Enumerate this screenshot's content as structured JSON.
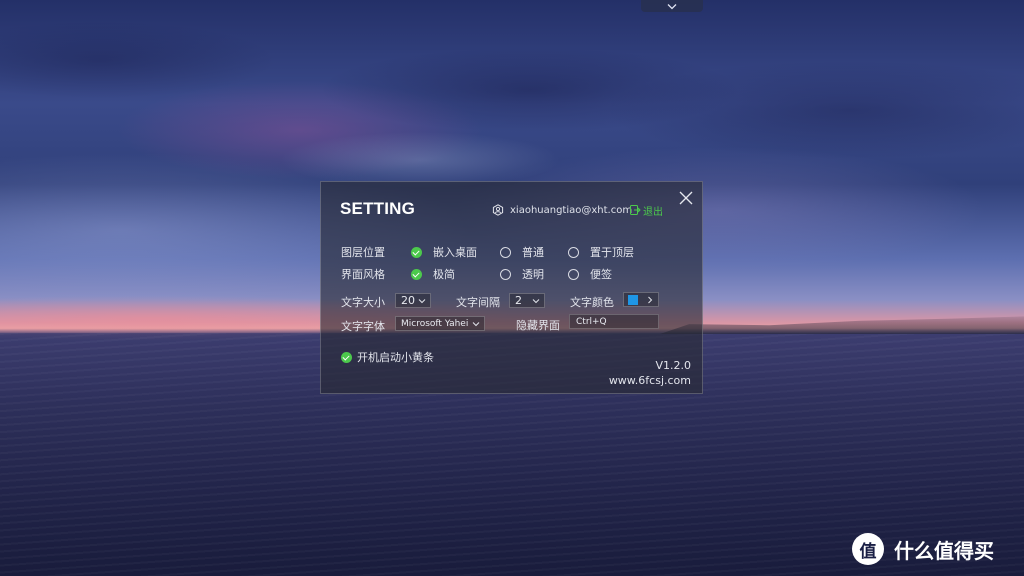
{
  "panel": {
    "title": "SETTING",
    "user_email": "xiaohuangtiao@xht.com",
    "logout_label": "退出",
    "rows": {
      "layer": {
        "label": "图层位置",
        "options": [
          "嵌入桌面",
          "普通",
          "置于顶层"
        ],
        "selected": "嵌入桌面"
      },
      "style": {
        "label": "界面风格",
        "options": [
          "极简",
          "透明",
          "便签"
        ],
        "selected": "极简"
      }
    },
    "font_size": {
      "label": "文字大小",
      "value": "20"
    },
    "line_spacing": {
      "label": "文字间隔",
      "value": "2"
    },
    "text_color": {
      "label": "文字颜色",
      "value": "#1e96e6"
    },
    "font_family": {
      "label": "文字字体",
      "value": "Microsoft Yahei"
    },
    "hide_ui": {
      "label": "隐藏界面",
      "hotkey": "Ctrl+Q"
    },
    "autostart": {
      "label": "开机启动小黄条",
      "checked": true
    },
    "version": "V1.2.0",
    "website": "www.6fcsj.com"
  },
  "watermark": {
    "text": "什么值得买",
    "logo_char": "值"
  },
  "colors": {
    "accent_green": "#4cc94c",
    "swatch_blue": "#1e96e6"
  },
  "icons": {
    "top_tab": "chevron-down-icon",
    "close": "close-icon",
    "user": "user-hex-icon",
    "logout": "logout-icon"
  }
}
